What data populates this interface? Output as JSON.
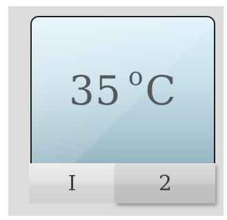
{
  "display": {
    "temperature_value": "35",
    "degree_symbol": "o",
    "unit": "C"
  },
  "tabs": [
    {
      "label": "I",
      "selected": false
    },
    {
      "label": "2",
      "selected": true
    }
  ],
  "colors": {
    "panel_background": "#dcdcdc",
    "display_gradient_top": "#dff2fb",
    "display_gradient_bottom": "#8fb0bd",
    "display_border": "#1e1e1e",
    "text": "#555a5c"
  }
}
